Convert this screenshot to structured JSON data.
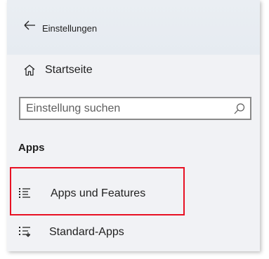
{
  "window": {
    "title": "Einstellungen",
    "back_icon": "arrow-left-icon"
  },
  "home": {
    "label": "Startseite",
    "icon": "home-icon"
  },
  "search": {
    "placeholder": "Einstellung suchen",
    "value": "",
    "icon": "search-icon"
  },
  "section": {
    "heading": "Apps"
  },
  "nav": {
    "items": [
      {
        "label": "Apps und Features",
        "icon": "list-icon",
        "highlighted": true
      },
      {
        "label": "Standard-Apps",
        "icon": "default-apps-icon",
        "highlighted": false
      }
    ]
  },
  "colors": {
    "highlight": "#e81123",
    "panel_bg": "#f1f2f5",
    "titlebar_bg": "#e6ebf1",
    "text": "#1f1f1f"
  }
}
